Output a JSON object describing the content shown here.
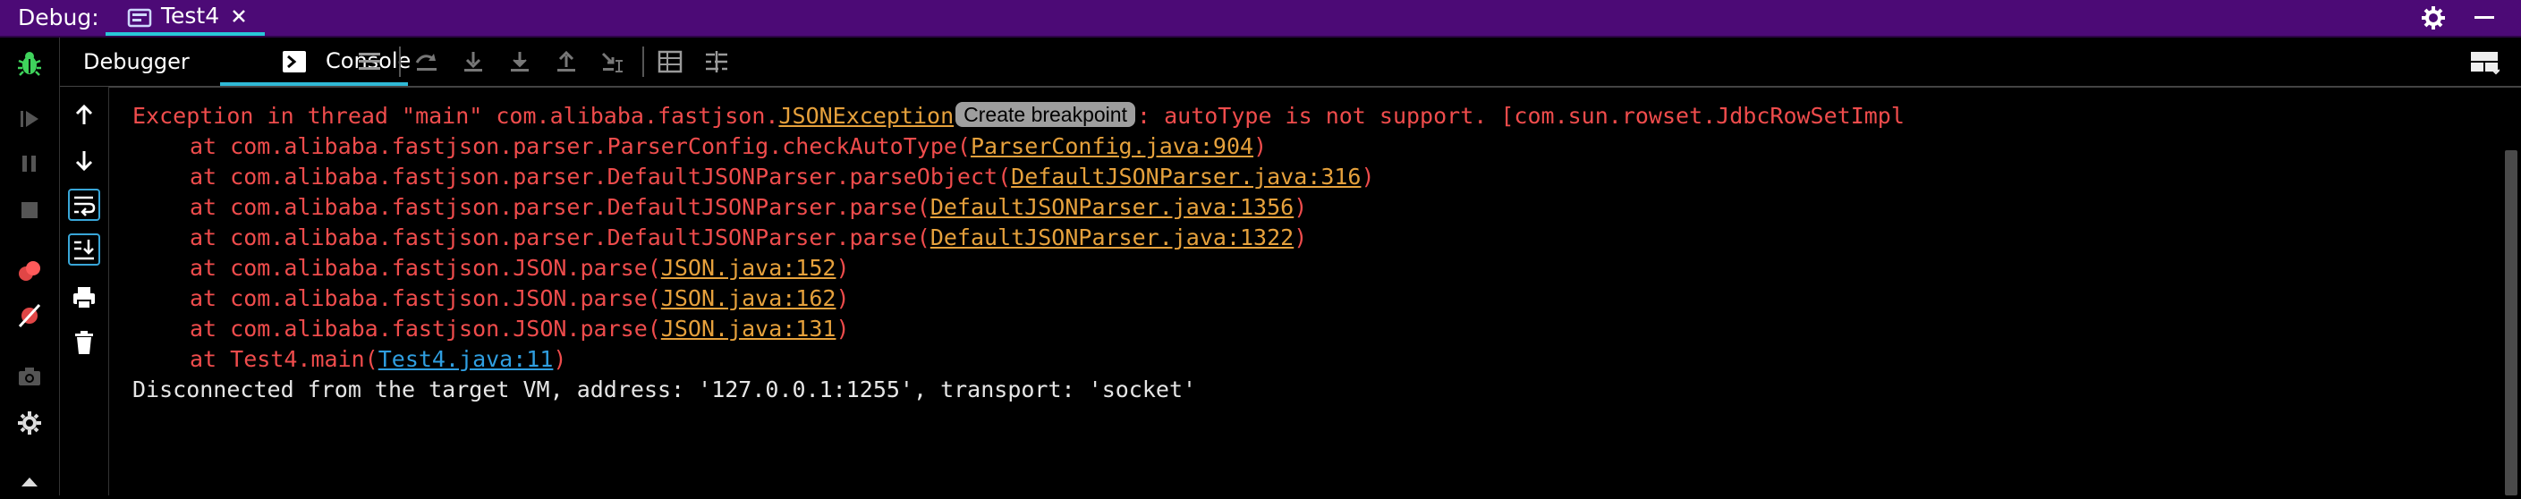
{
  "titlebar": {
    "debug_label": "Debug:",
    "tab_label": "Test4"
  },
  "tabs": {
    "debugger": "Debugger",
    "console": "Console"
  },
  "colors": {
    "titlebar_bg": "#4c0a76",
    "accent": "#2fb9d6",
    "error_text": "#ef4c4c",
    "source_link": "#e6a13c",
    "user_link": "#2f9ee0"
  },
  "icons": {
    "left_toolbar": [
      "bug-icon",
      "rerun-icon",
      "pause-icon",
      "stop-icon",
      "view-breakpoints-icon",
      "mute-breakpoints-icon",
      "camera-icon",
      "settings-icon",
      "pin-icon"
    ],
    "console_toolbar": [
      "up-arrow-icon",
      "down-arrow-icon",
      "soft-wrap-icon",
      "scroll-to-end-icon",
      "print-icon",
      "trash-icon"
    ],
    "tab_toolbar": [
      "menu-icon",
      "step-over-icon",
      "step-into-icon",
      "force-step-into-icon",
      "step-out-icon",
      "run-to-cursor-icon",
      "evaluate-icon",
      "trace-icon",
      "layout-icon"
    ]
  },
  "console": {
    "exception_prefix": "Exception in thread \"main\" com.alibaba.fastjson.",
    "exception_class": "JSONException",
    "breakpoint_hint": "Create breakpoint",
    "exception_message": ": autoType is not support. [com.sun.rowset.JdbcRowSetImpl",
    "frames": [
      {
        "method": "at com.alibaba.fastjson.parser.ParserConfig.checkAutoType(",
        "link": "ParserConfig.java:904",
        "close": ")"
      },
      {
        "method": "at com.alibaba.fastjson.parser.DefaultJSONParser.parseObject(",
        "link": "DefaultJSONParser.java:316",
        "close": ")"
      },
      {
        "method": "at com.alibaba.fastjson.parser.DefaultJSONParser.parse(",
        "link": "DefaultJSONParser.java:1356",
        "close": ")"
      },
      {
        "method": "at com.alibaba.fastjson.parser.DefaultJSONParser.parse(",
        "link": "DefaultJSONParser.java:1322",
        "close": ")"
      },
      {
        "method": "at com.alibaba.fastjson.JSON.parse(",
        "link": "JSON.java:152",
        "close": ")"
      },
      {
        "method": "at com.alibaba.fastjson.JSON.parse(",
        "link": "JSON.java:162",
        "close": ")"
      },
      {
        "method": "at com.alibaba.fastjson.JSON.parse(",
        "link": "JSON.java:131",
        "close": ")"
      },
      {
        "method": "at Test4.main(",
        "link": "Test4.java:11",
        "close": ")"
      }
    ],
    "disconnect_message": "Disconnected from the target VM, address: '127.0.0.1:1255', transport: 'socket'"
  }
}
